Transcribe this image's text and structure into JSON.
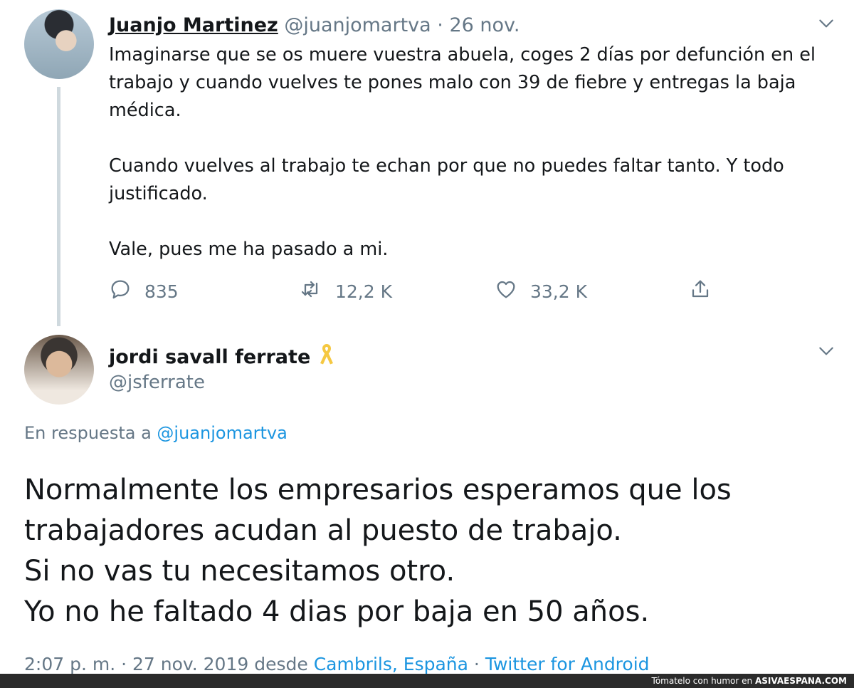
{
  "tweet1": {
    "name": "Juanjo Martinez",
    "handle": "@juanjomartva",
    "sep": "·",
    "date": "26 nov.",
    "lines": [
      "Imaginarse que se os muere vuestra abuela, coges 2 días por defunción en el",
      "trabajo y cuando vuelves te pones malo con 39 de fiebre y entregas la baja",
      "médica.",
      "",
      "Cuando vuelves al trabajo te echan por que no puedes faltar tanto. Y todo",
      "justificado.",
      "",
      "Vale, pues me ha pasado a mi."
    ],
    "replies": "835",
    "retweets": "12,2 K",
    "likes": "33,2 K"
  },
  "tweet2": {
    "name": "jordi savall ferrate",
    "handle": "@jsferrate",
    "reply_prefix": "En respuesta a",
    "reply_to": "@juanjomartva",
    "lines": [
      "Normalmente los empresarios esperamos que los",
      "trabajadores acudan al puesto de trabajo.",
      "Si no vas tu necesitamos otro.",
      "Yo no he faltado 4 dias por baja en 50 años."
    ],
    "time": "2:07 p. m. · 27 nov. 2019 desde",
    "location": "Cambrils, España",
    "sep": "·",
    "client": "Twitter for Android"
  },
  "footer": {
    "text": "Tómatelo con humor en",
    "brand": "ASIVAESPANA.COM"
  },
  "icons": {
    "reply": "reply-icon",
    "retweet": "retweet-icon",
    "like": "heart-icon",
    "share": "share-icon",
    "menu": "chevron-down-icon",
    "ribbon": "yellow-ribbon-icon"
  },
  "colors": {
    "text": "#14171a",
    "muted": "#657786",
    "link": "#1b95e0",
    "ribbon": "#f5c842",
    "thread_line": "#cfd9de"
  }
}
